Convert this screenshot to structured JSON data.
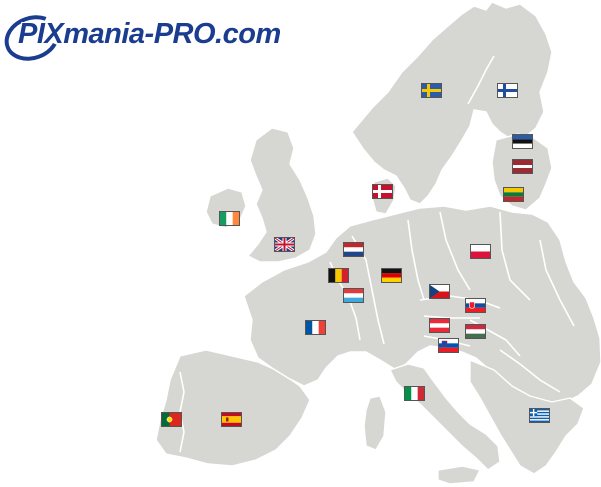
{
  "logo": {
    "text": "PIXmania-PRO.com",
    "color": "#1b3d8f"
  },
  "map": {
    "land_color": "#d6d6d2",
    "border_color": "#ffffff"
  },
  "flags": [
    {
      "country": "sweden",
      "icon": "sweden-flag-icon"
    },
    {
      "country": "finland",
      "icon": "finland-flag-icon"
    },
    {
      "country": "estonia",
      "icon": "estonia-flag-icon"
    },
    {
      "country": "latvia",
      "icon": "latvia-flag-icon"
    },
    {
      "country": "lithuania",
      "icon": "lithuania-flag-icon"
    },
    {
      "country": "denmark",
      "icon": "denmark-flag-icon"
    },
    {
      "country": "ireland",
      "icon": "ireland-flag-icon"
    },
    {
      "country": "united-kingdom",
      "icon": "united-kingdom-flag-icon"
    },
    {
      "country": "netherlands",
      "icon": "netherlands-flag-icon"
    },
    {
      "country": "poland",
      "icon": "poland-flag-icon"
    },
    {
      "country": "belgium",
      "icon": "belgium-flag-icon"
    },
    {
      "country": "germany",
      "icon": "germany-flag-icon"
    },
    {
      "country": "luxembourg",
      "icon": "luxembourg-flag-icon"
    },
    {
      "country": "czech-republic",
      "icon": "czech-republic-flag-icon"
    },
    {
      "country": "slovakia",
      "icon": "slovakia-flag-icon"
    },
    {
      "country": "france",
      "icon": "france-flag-icon"
    },
    {
      "country": "austria",
      "icon": "austria-flag-icon"
    },
    {
      "country": "hungary",
      "icon": "hungary-flag-icon"
    },
    {
      "country": "slovenia",
      "icon": "slovenia-flag-icon"
    },
    {
      "country": "italy",
      "icon": "italy-flag-icon"
    },
    {
      "country": "portugal",
      "icon": "portugal-flag-icon"
    },
    {
      "country": "spain",
      "icon": "spain-flag-icon"
    },
    {
      "country": "greece",
      "icon": "greece-flag-icon"
    }
  ]
}
